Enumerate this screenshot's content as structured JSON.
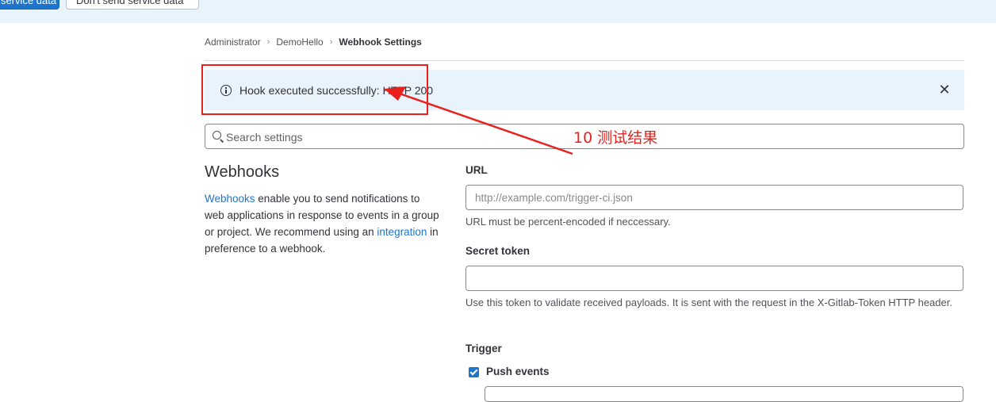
{
  "topbar": {
    "primary_button_label": "service data",
    "secondary_button_label": "Don't send service data"
  },
  "breadcrumb": {
    "items": [
      "Administrator",
      "DemoHello",
      "Webhook Settings"
    ]
  },
  "alert": {
    "icon": "info-icon",
    "message": "Hook executed successfully: HTTP 200",
    "close_icon": "close-icon"
  },
  "search": {
    "placeholder": "Search settings",
    "value": ""
  },
  "annotation": {
    "label": "10 测试结果",
    "color": "#e8211e"
  },
  "section": {
    "title": "Webhooks",
    "desc_link1": "Webhooks",
    "desc_text1": " enable you to send notifications to web applications in response to events in a group or project. We recommend using an ",
    "desc_link2": "integration",
    "desc_text2": " in preference to a webhook."
  },
  "form": {
    "url_label": "URL",
    "url_placeholder": "http://example.com/trigger-ci.json",
    "url_value": "",
    "url_help": "URL must be percent-encoded if neccessary.",
    "secret_label": "Secret token",
    "secret_value": "",
    "secret_help": "Use this token to validate received payloads. It is sent with the request in the X-Gitlab-Token HTTP header.",
    "trigger_label": "Trigger",
    "push_events_label": "Push events",
    "push_events_checked": true
  },
  "colors": {
    "accent": "#1f75cb",
    "alert_bg": "#e9f3fc",
    "annotation": "#e8211e"
  }
}
